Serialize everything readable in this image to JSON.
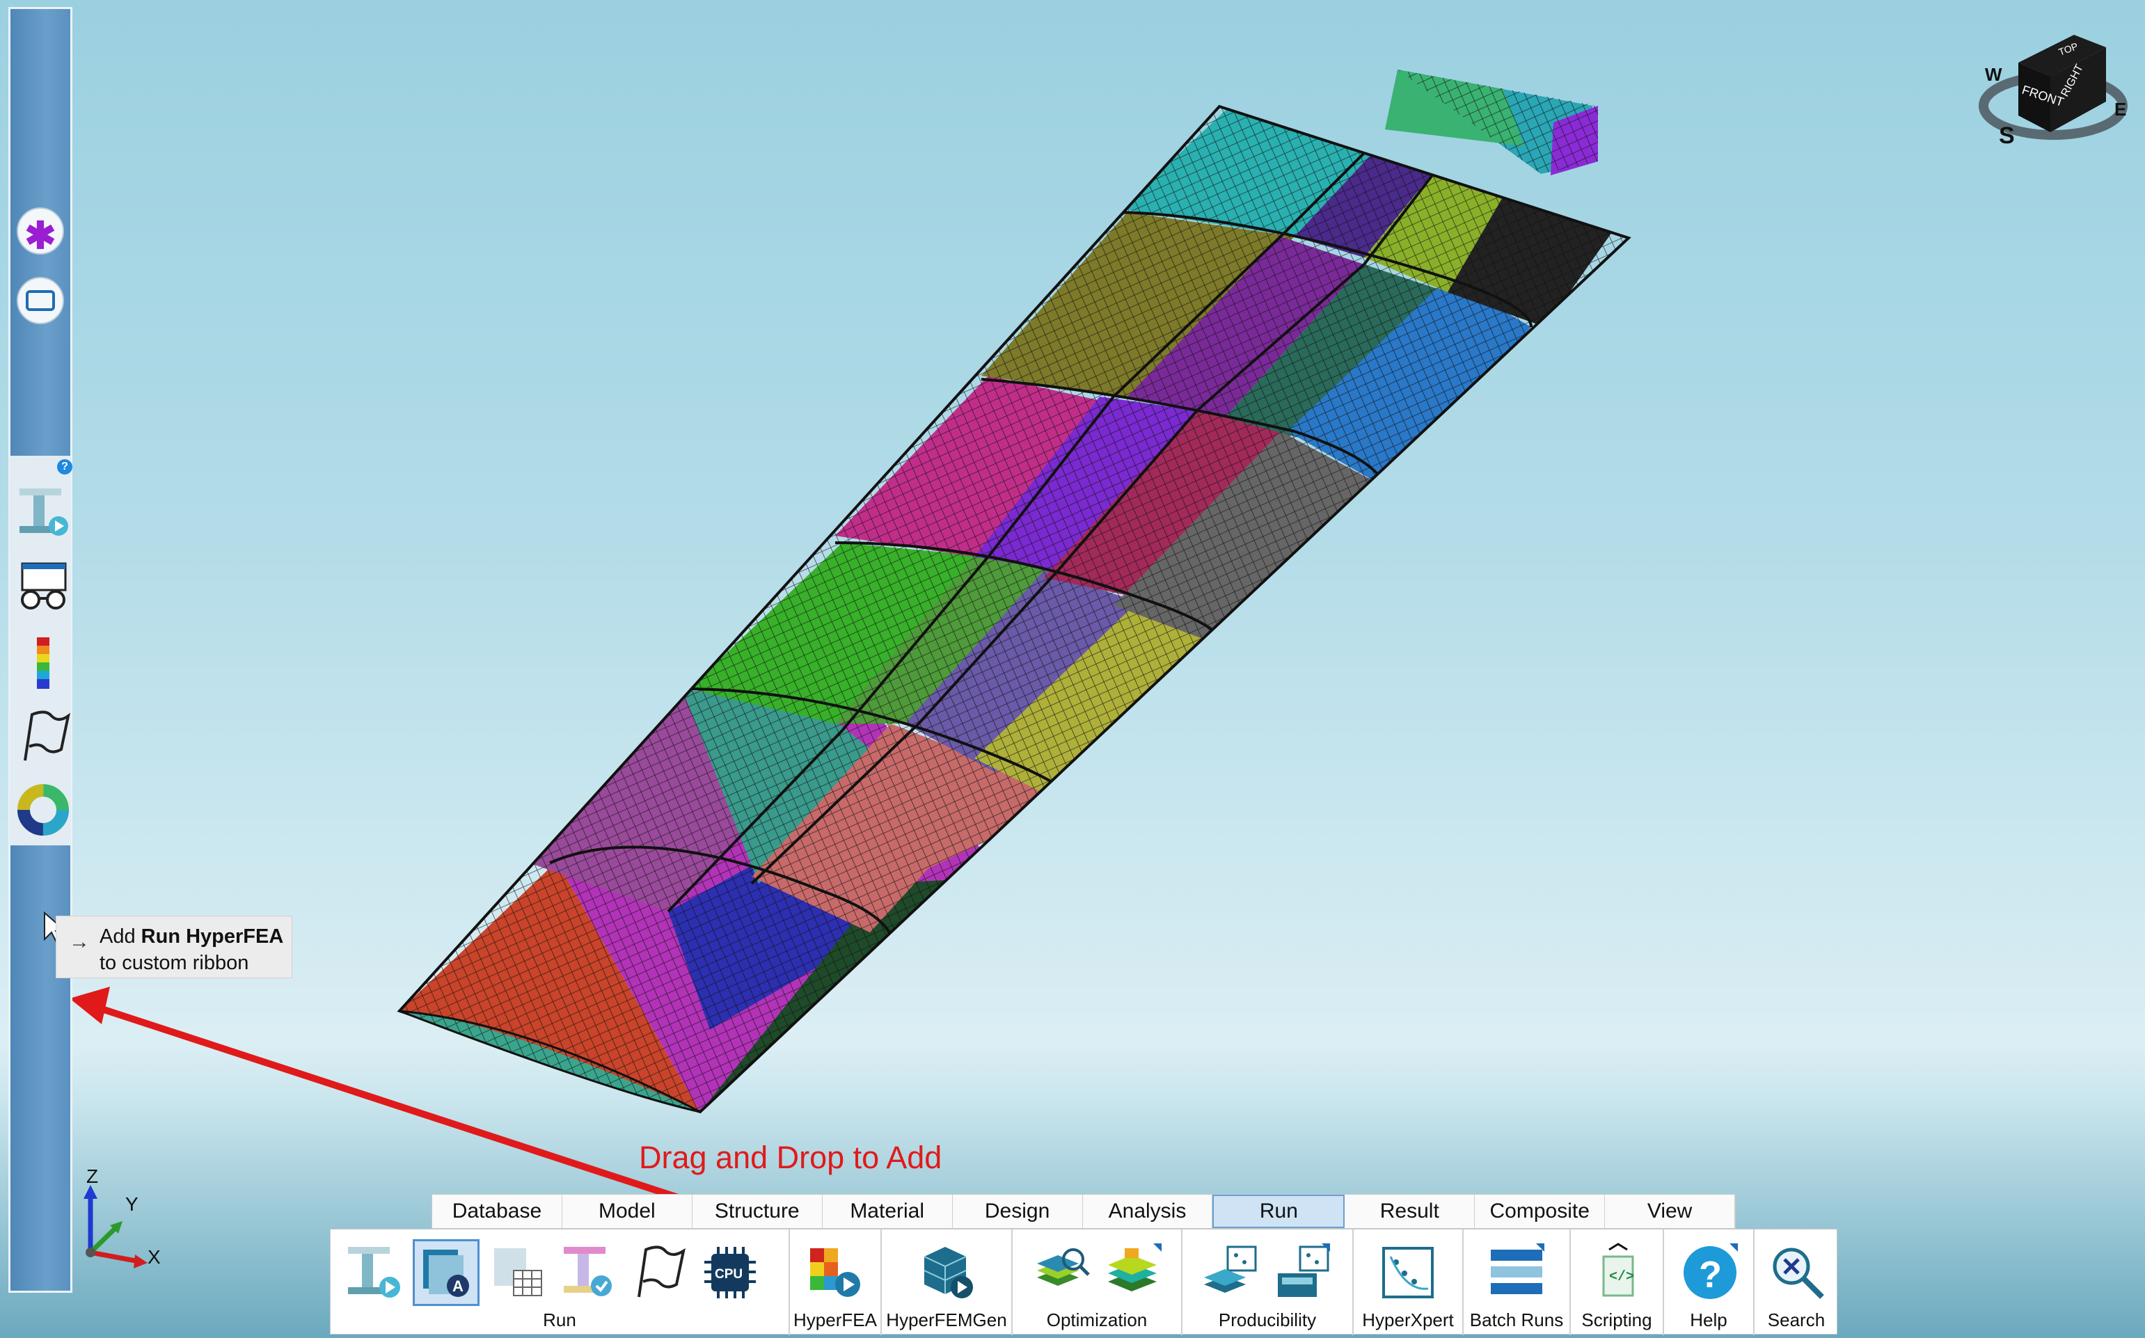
{
  "tooltip": {
    "prefix": "Add ",
    "bold": "Run HyperFEA",
    "line2": "to custom ribbon"
  },
  "drag_hint": "Drag and Drop to Add",
  "view_cube": {
    "top": "TOP",
    "front": "FRONT",
    "right": "RIGHT",
    "compass_s": "S",
    "compass_e": "E",
    "compass_w": "W"
  },
  "axes": {
    "x": "X",
    "y": "Y",
    "z": "Z"
  },
  "left_ribbon": {
    "help": "?"
  },
  "tabs": [
    "Database",
    "Model",
    "Structure",
    "Material",
    "Design",
    "Analysis",
    "Run",
    "Result",
    "Composite",
    "View"
  ],
  "active_tab": "Run",
  "toolbar": {
    "groups": [
      "Run",
      "HyperFEA",
      "HyperFEMGen",
      "Optimization",
      "Producibility",
      "HyperXpert",
      "Batch Runs",
      "Scripting",
      "Help",
      "Search"
    ],
    "cpu_label": "CPU"
  },
  "colors": {
    "accent": "#1e6db8",
    "arrow": "#e01a1a",
    "ribbon": "#5b91c0"
  },
  "icons": [
    "asterisk-icon",
    "rectangle-icon",
    "model-run-icon",
    "glasses-icon",
    "legend-icon",
    "flag-icon",
    "donut-icon",
    "cpu-icon",
    "search-icon",
    "help-icon"
  ]
}
